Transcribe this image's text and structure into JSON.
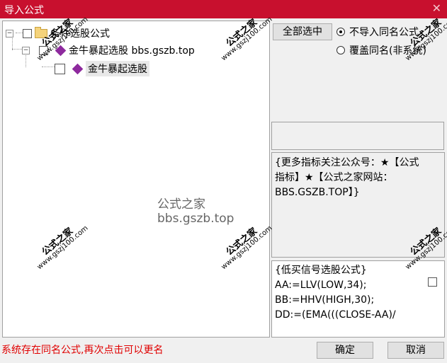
{
  "window": {
    "title": "导入公式"
  },
  "tree": {
    "root_label": "条件选股公式",
    "child_label": "金牛暴起选股 bbs.gszb.top",
    "leaf_label": "金牛暴起选股"
  },
  "buttons": {
    "select_all": "全部选中",
    "ok": "确定",
    "cancel": "取消"
  },
  "options": {
    "no_import": "不导入同名公式",
    "overwrite": "覆盖同名(非系统)"
  },
  "description": "{更多指标关注公众号：★【公式指标】★【公式之家网站：BBS.GSZB.TOP】}",
  "formula_text": "{低买信号选股公式}\nAA:=LLV(LOW,34);\nBB:=HHV(HIGH,30);\nDD:=(EMA(((CLOSE-AA)/",
  "status": "系统存在同名公式,再次点击可以更名",
  "watermark": {
    "title": "公式之家",
    "url": "www.gszj100.com",
    "center": "公式之家 bbs.gszb.top"
  }
}
